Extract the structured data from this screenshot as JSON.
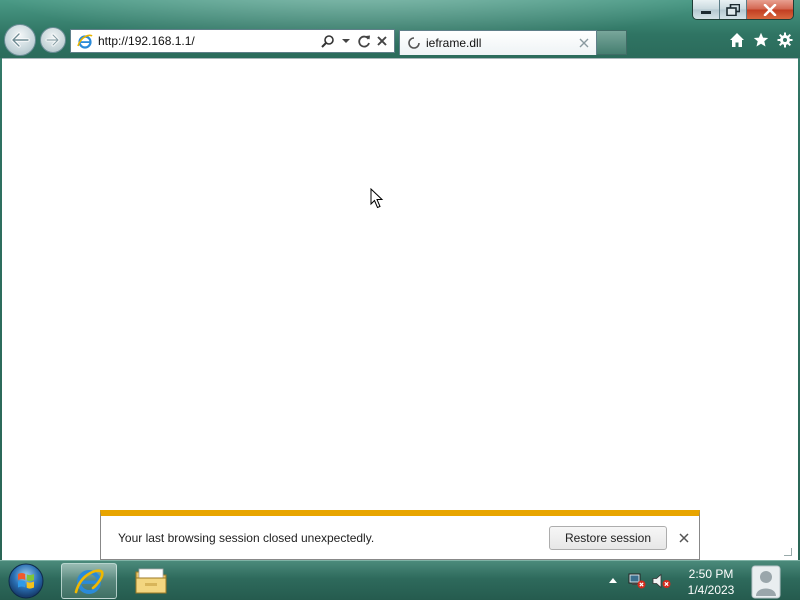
{
  "browser": {
    "address_url": "http://192.168.1.1/",
    "tab_title": "ieframe.dll",
    "icons": {
      "back": "back-arrow-icon",
      "forward": "forward-arrow-icon",
      "search": "search-icon",
      "refresh": "refresh-icon",
      "stop": "stop-icon",
      "home": "home-icon",
      "favorites": "star-icon",
      "tools": "gear-icon"
    }
  },
  "notification": {
    "message": "Your last browsing session closed unexpectedly.",
    "restore_label": "Restore session",
    "accent_color": "#e8a500"
  },
  "taskbar": {
    "time": "2:50 PM",
    "date": "1/4/2023",
    "apps": [
      "internet-explorer",
      "windows-explorer"
    ]
  },
  "colors": {
    "frame": "#2f7262",
    "close_button": "#c23d22",
    "content_bg": "#ffffff"
  }
}
